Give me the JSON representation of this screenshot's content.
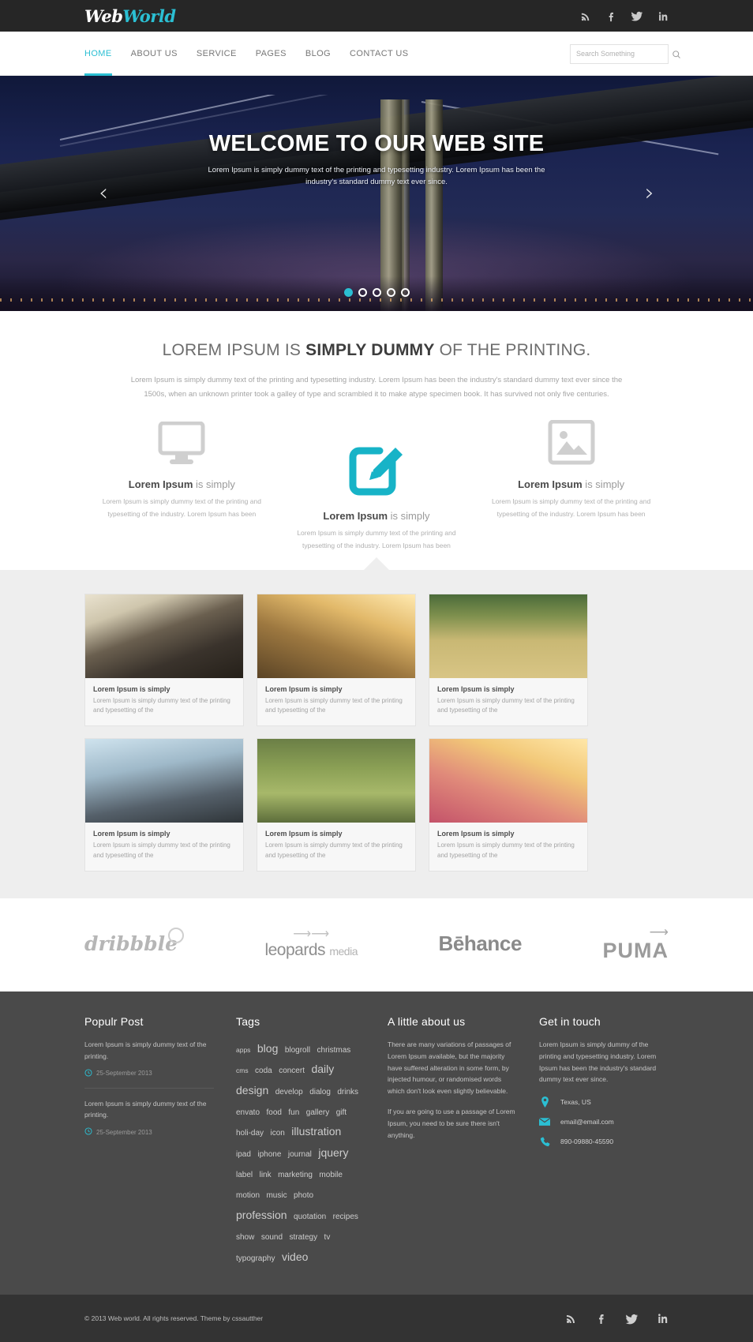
{
  "brand": {
    "name_part1": "Web",
    "name_part2": "World",
    "accent_color": "#2bbfd3"
  },
  "topbar": {
    "social": [
      {
        "name": "rss-icon",
        "label": "RSS"
      },
      {
        "name": "facebook-icon",
        "label": "Facebook"
      },
      {
        "name": "twitter-icon",
        "label": "Twitter"
      },
      {
        "name": "linkedin-icon",
        "label": "LinkedIn"
      }
    ]
  },
  "nav": {
    "items": [
      {
        "label": "HOME",
        "active": true
      },
      {
        "label": "ABOUT US",
        "active": false
      },
      {
        "label": "SERVICE",
        "active": false
      },
      {
        "label": "PAGES",
        "active": false
      },
      {
        "label": "BLOG",
        "active": false
      },
      {
        "label": "CONTACT US",
        "active": false
      }
    ],
    "search": {
      "placeholder": "Search Something",
      "value": ""
    }
  },
  "hero": {
    "title": "WELCOME TO OUR WEB SITE",
    "subtitle": "Lorem Ipsum is simply dummy text of the printing and typesetting industry. Lorem Ipsum has been the industry's standard dummy text ever since.",
    "prev_label": "‹",
    "next_label": "›",
    "slides": 5,
    "active_slide": 1
  },
  "intro": {
    "heading_pre": "LOREM IPSUM IS ",
    "heading_bold": "SIMPLY DUMMY",
    "heading_post": " OF THE PRINTING.",
    "paragraph": "Lorem Ipsum is simply dummy text of the printing and typesetting industry. Lorem Ipsum has been the industry's standard dummy text ever since the 1500s, when an unknown printer took a galley of type and scrambled it to make atype specimen book. It has survived not only five centuries."
  },
  "features": [
    {
      "icon": "monitor-icon",
      "title_bold": "Lorem Ipsum",
      "title_rest": " is simply",
      "text": "Lorem Ipsum is simply dummy text of the printing and typesetting of the industry. Lorem Ipsum has been"
    },
    {
      "icon": "edit-pencil-icon",
      "title_bold": "Lorem Ipsum",
      "title_rest": " is simply",
      "text": "Lorem Ipsum is simply dummy text of the printing and typesetting of the industry. Lorem Ipsum has been"
    },
    {
      "icon": "image-icon",
      "title_bold": "Lorem Ipsum",
      "title_rest": " is simply",
      "text": "Lorem Ipsum is simply dummy text of the printing and typesetting of the industry. Lorem Ipsum has been"
    }
  ],
  "portfolio": [
    {
      "thumb": "vintage-car-photo",
      "title": "Lorem Ipsum is simply",
      "text": "Lorem Ipsum is simply dummy text of the printing and typesetting of the"
    },
    {
      "thumb": "sunset-field-photo",
      "title": "Lorem Ipsum is simply",
      "text": "Lorem Ipsum is simply dummy text of the printing and typesetting of the"
    },
    {
      "thumb": "wheat-field-photo",
      "title": "Lorem Ipsum is simply",
      "text": "Lorem Ipsum is simply dummy text of the printing and typesetting of the"
    },
    {
      "thumb": "eyeglasses-photo",
      "title": "Lorem Ipsum is simply",
      "text": "Lorem Ipsum is simply dummy text of the printing and typesetting of the"
    },
    {
      "thumb": "green-wheat-photo",
      "title": "Lorem Ipsum is simply",
      "text": "Lorem Ipsum is simply dummy text of the printing and typesetting of the"
    },
    {
      "thumb": "raspberries-photo",
      "title": "Lorem Ipsum is simply",
      "text": "Lorem Ipsum is simply dummy text of the printing and typesetting of the"
    }
  ],
  "clients": [
    {
      "name": "dribbble-logo",
      "label": "dribbble"
    },
    {
      "name": "leopards-media-logo",
      "label": "leopards",
      "sub": "media"
    },
    {
      "name": "behance-logo",
      "label": "Bēhance"
    },
    {
      "name": "puma-logo",
      "label": "PUMA"
    }
  ],
  "footer": {
    "popular": {
      "heading": "Populr Post",
      "posts": [
        {
          "text": "Lorem Ipsum is simply dummy text of the printing.",
          "date": "25-September 2013"
        },
        {
          "text": "Lorem Ipsum is simply dummy text of the printing.",
          "date": "25-September 2013"
        }
      ]
    },
    "tags": {
      "heading": "Tags",
      "items": [
        {
          "label": "apps",
          "size": "t-s"
        },
        {
          "label": "blog",
          "size": "t-xl"
        },
        {
          "label": "blogroll",
          "size": "t-m"
        },
        {
          "label": "christmas",
          "size": "t-m"
        },
        {
          "label": "cms",
          "size": "t-s"
        },
        {
          "label": "coda",
          "size": "t-m"
        },
        {
          "label": "concert",
          "size": "t-m"
        },
        {
          "label": "daily",
          "size": "t-xl"
        },
        {
          "label": "design",
          "size": "t-xl"
        },
        {
          "label": "develop",
          "size": "t-m"
        },
        {
          "label": "dialog",
          "size": "t-m"
        },
        {
          "label": "drinks",
          "size": "t-m"
        },
        {
          "label": "envato",
          "size": "t-m"
        },
        {
          "label": "food",
          "size": "t-m"
        },
        {
          "label": "fun",
          "size": "t-m"
        },
        {
          "label": "gallery",
          "size": "t-m"
        },
        {
          "label": "gift",
          "size": "t-m"
        },
        {
          "label": "holi-day",
          "size": "t-m"
        },
        {
          "label": "icon",
          "size": "t-m"
        },
        {
          "label": "illustration",
          "size": "t-xl"
        },
        {
          "label": "ipad",
          "size": "t-m"
        },
        {
          "label": "iphone",
          "size": "t-m"
        },
        {
          "label": "journal",
          "size": "t-m"
        },
        {
          "label": "jquery",
          "size": "t-xl"
        },
        {
          "label": "label",
          "size": "t-m"
        },
        {
          "label": "link",
          "size": "t-m"
        },
        {
          "label": "marketing",
          "size": "t-m"
        },
        {
          "label": "mobile",
          "size": "t-m"
        },
        {
          "label": "motion",
          "size": "t-m"
        },
        {
          "label": "music",
          "size": "t-m"
        },
        {
          "label": "photo",
          "size": "t-m"
        },
        {
          "label": "profession",
          "size": "t-xl"
        },
        {
          "label": "quotation",
          "size": "t-m"
        },
        {
          "label": "recipes",
          "size": "t-m"
        },
        {
          "label": "show",
          "size": "t-m"
        },
        {
          "label": "sound",
          "size": "t-m"
        },
        {
          "label": "strategy",
          "size": "t-m"
        },
        {
          "label": "tv",
          "size": "t-m"
        },
        {
          "label": "typography",
          "size": "t-m"
        },
        {
          "label": "video",
          "size": "t-xl"
        }
      ]
    },
    "about": {
      "heading": "A little about us",
      "paragraph1": "There are many variations of passages of Lorem Ipsum available, but the majority have suffered alteration in some form, by injected humour, or randomised words which don't look even slightly believable.",
      "paragraph2": "If you are going to use a passage of Lorem Ipsum, you need to be sure there isn't anything."
    },
    "contact": {
      "heading": "Get in touch",
      "paragraph": "Lorem Ipsum is simply dummy of the printing and typesetting industry. Lorem Ipsum has been the industry's standard dummy text ever since.",
      "items": [
        {
          "icon": "location-pin-icon",
          "value": "Texas, US"
        },
        {
          "icon": "envelope-icon",
          "value": "email@email.com"
        },
        {
          "icon": "phone-icon",
          "value": "890-09880-45590"
        }
      ]
    }
  },
  "bottombar": {
    "copyright": "© 2013 Web world. All rights reserved. Theme by cssautther",
    "social": [
      {
        "name": "rss-icon",
        "label": "RSS"
      },
      {
        "name": "facebook-icon",
        "label": "Facebook"
      },
      {
        "name": "twitter-icon",
        "label": "Twitter"
      },
      {
        "name": "linkedin-icon",
        "label": "LinkedIn"
      }
    ]
  }
}
